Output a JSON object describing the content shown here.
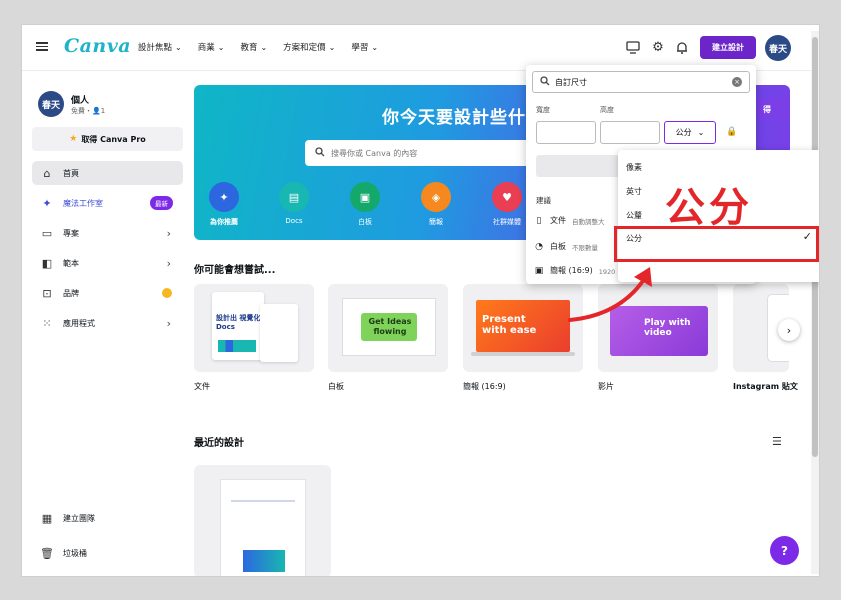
{
  "topbar": {
    "logo": "Canva",
    "nav": [
      "設計焦點",
      "商業",
      "教育",
      "方案和定價",
      "學習"
    ],
    "create_button": "建立設計",
    "avatar": "春天"
  },
  "sidebar": {
    "account_avatar": "春天",
    "account_name": "個人",
    "account_sub": "免費・👤1",
    "pro_button": "取得 Canva Pro",
    "items": [
      {
        "label": "首頁"
      },
      {
        "label": "魔法工作室",
        "badge": "最新"
      },
      {
        "label": "專案"
      },
      {
        "label": "範本"
      },
      {
        "label": "品牌"
      },
      {
        "label": "應用程式"
      }
    ],
    "bottom": [
      {
        "label": "建立團隊"
      },
      {
        "label": "垃圾桶"
      }
    ]
  },
  "hero": {
    "title": "你今天要設計些什",
    "search_placeholder": "搜尋你或 Canva 的內容",
    "button": "得",
    "categories": [
      {
        "label": "為你推薦",
        "color": "#2d67e0"
      },
      {
        "label": "Docs",
        "color": "#18b7b2"
      },
      {
        "label": "白板",
        "color": "#14a96a"
      },
      {
        "label": "簡報",
        "color": "#f5891f"
      },
      {
        "label": "社群媒體",
        "color": "#ea3e53"
      }
    ]
  },
  "suggestions": {
    "title": "你可能會想嘗試...",
    "cards": [
      {
        "label": "文件",
        "thumb_title": "設計出 視覺化Docs"
      },
      {
        "label": "白板",
        "thumb_title": "Get Ideas flowing"
      },
      {
        "label": "簡報 (16:9)",
        "thumb_title": "Present with ease"
      },
      {
        "label": "影片",
        "thumb_title": "Play with video"
      },
      {
        "label": "Instagram 貼文",
        "thumb_title": ""
      }
    ]
  },
  "recent": {
    "title": "最近的設計"
  },
  "help_button": "?",
  "size_panel": {
    "search_value": "自訂尺寸",
    "width_label": "寬度",
    "height_label": "高度",
    "unit": "公分",
    "suggestions_label": "建議",
    "rows": [
      {
        "label": "文件",
        "sub": "自動調整大"
      },
      {
        "label": "白板",
        "sub": "不限數量"
      },
      {
        "label": "簡報 (16:9)",
        "sub": "1920 × 1080 像素"
      }
    ]
  },
  "unit_menu": {
    "options": [
      "像素",
      "英寸",
      "公釐",
      "公分"
    ],
    "selected": "公分"
  },
  "annotation": {
    "callout": "公分",
    "color": "#e3262a"
  },
  "colors": {
    "brand_purple": "#7d2ae8",
    "logo_teal": "#1fb3c9"
  }
}
